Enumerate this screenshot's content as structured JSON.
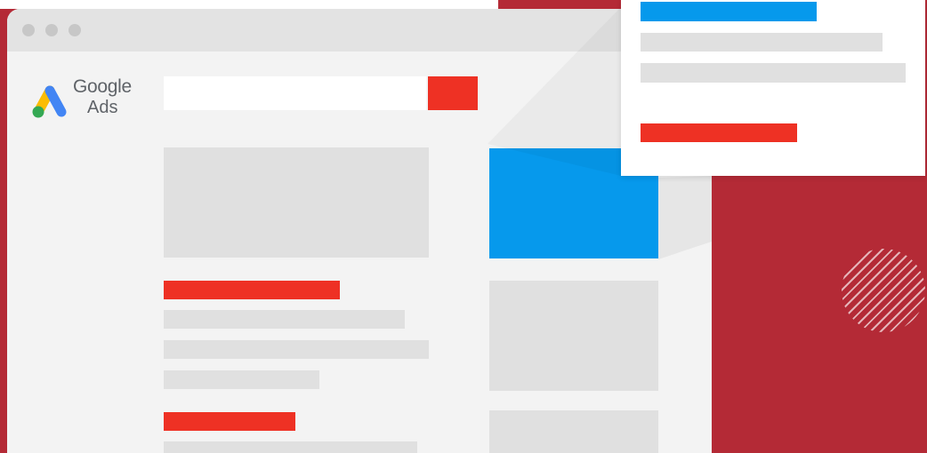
{
  "browser": {
    "window_controls": [
      "dot",
      "dot",
      "dot"
    ]
  },
  "logo": {
    "brand_line": "Google",
    "product_line": "Ads",
    "mark_colors": [
      "#fbbc04",
      "#4285f4",
      "#34a853"
    ]
  },
  "search": {
    "input_value": "",
    "button_icon": "search-icon"
  },
  "colors": {
    "background_red": "#b42a36",
    "accent_red": "#ee3124",
    "accent_blue": "#0699ec",
    "placeholder_gray": "#e0e0e0",
    "window_gray": "#f3f3f3"
  }
}
